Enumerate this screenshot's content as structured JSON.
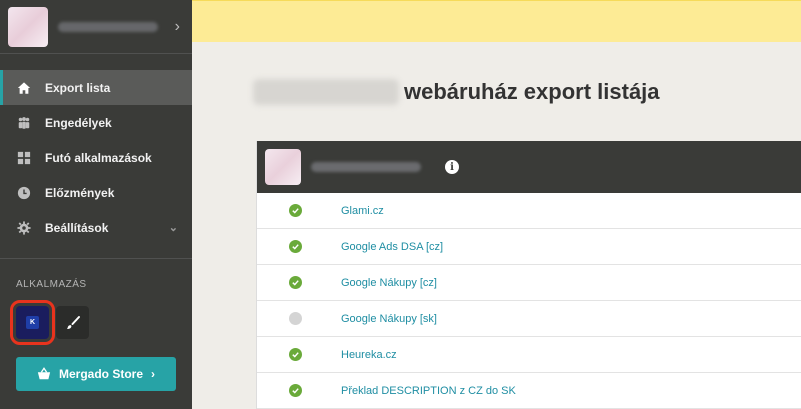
{
  "sidebar": {
    "items": [
      {
        "label": "Export lista",
        "icon": "home-icon"
      },
      {
        "label": "Engedélyek",
        "icon": "users-icon"
      },
      {
        "label": "Futó alkalmazások",
        "icon": "grid-icon"
      },
      {
        "label": "Előzmények",
        "icon": "clock-icon"
      },
      {
        "label": "Beállítások",
        "icon": "gear-icon"
      }
    ],
    "apps_title": "ALKALMAZÁS",
    "app_k_label": "K",
    "store_button": "Mergado Store"
  },
  "main": {
    "title_suffix": "webáruház export listája",
    "rows": [
      {
        "label": "Glami.cz",
        "status": "active"
      },
      {
        "label": "Google Ads DSA [cz]",
        "status": "active"
      },
      {
        "label": "Google Nákupy [cz]",
        "status": "active"
      },
      {
        "label": "Google Nákupy [sk]",
        "status": "inactive"
      },
      {
        "label": "Heureka.cz",
        "status": "active"
      },
      {
        "label": "Překlad DESCRIPTION z CZ do SK",
        "status": "active"
      }
    ]
  },
  "colors": {
    "accent": "#27a3a6",
    "sidebar": "#3a3b38",
    "banner": "#fdeb95",
    "status_active": "#6aaa3a",
    "highlight": "#e8331d"
  }
}
